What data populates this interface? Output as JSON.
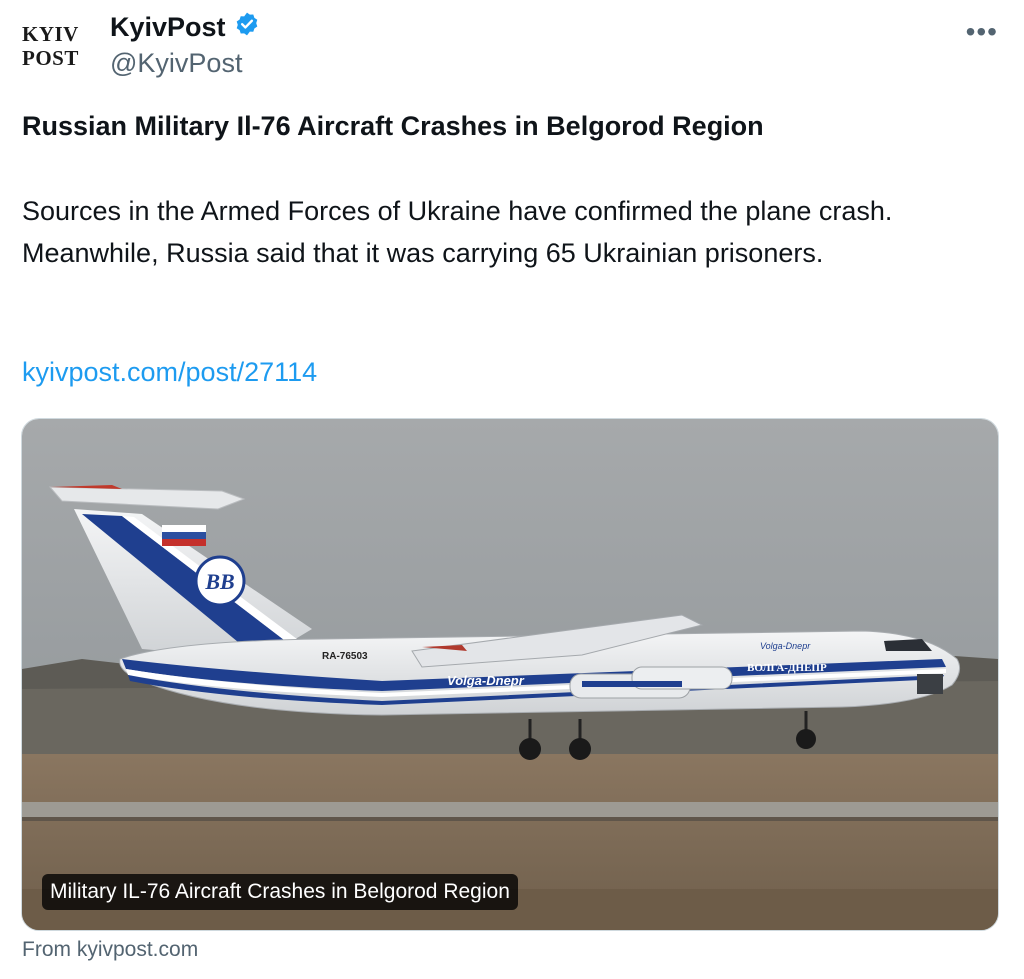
{
  "tweet": {
    "logo_line1": "KYIV",
    "logo_line2": "POST",
    "author_name": "KyivPost",
    "handle": "@KyivPost",
    "more_label": "•••",
    "headline": "Russian Military Il-76 Aircraft Crashes in Belgorod Region",
    "body": "Sources in the Armed Forces of Ukraine have confirmed the plane crash. Meanwhile, Russia said that it was carrying 65 Ukrainian prisoners.",
    "link": "kyivpost.com/post/27114"
  },
  "card": {
    "caption": "Military IL-76 Aircraft Crashes in Belgorod Region",
    "source": "From kyivpost.com",
    "image": {
      "registration": "RA-76503",
      "livery_text": "Volga-Dnepr",
      "nose_text": "Volga-Dnepr",
      "cyrillic_text": "ВОЛГА-ДНЕПР",
      "tail_logo": "ВВ"
    }
  },
  "colors": {
    "verified": "#1d9bf0",
    "link": "#1d9bf0",
    "livery_blue": "#1f3f8f",
    "sky": "#9ea3a6",
    "ground": "#7b6a55"
  }
}
